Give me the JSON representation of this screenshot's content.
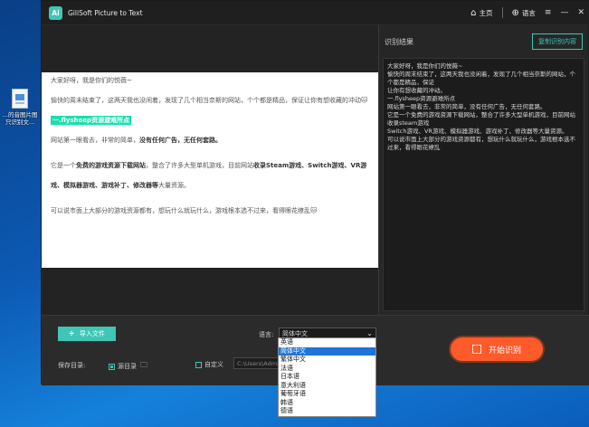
{
  "desktop": {
    "icon_label_line1": "…的音图片图",
    "icon_label_line2": "只识别文..."
  },
  "titlebar": {
    "logo_text": "Ai",
    "app_title": "GiliSoft Picture to Text",
    "home_label": "主页",
    "language_label": "语言"
  },
  "document": {
    "p1": "大家好呀，我是你们的悦薇~",
    "p2": "愉快的周末结束了，这两天我也没闲着，发现了几个相当奈斯的网站，个个都是精品，保证让你有想收藏的冲动🐱",
    "heading": "一.flysheep资源避难所点",
    "p3a": "网站第一眼看去，非常的简单，",
    "p3b": "没有任何广告，无任何套路。",
    "p4a": "它是一个",
    "p4b": "免费的游戏资源下载网站",
    "p4c": "，整合了许多大型单机游戏，目前网站",
    "p4d": "收录Steam游戏、Switch游戏、VR游戏、模拟器游戏、游戏补丁、修改器等",
    "p4e": "大量资源。",
    "p5": "可以说市面上大部分的游戏资源都有，想玩什么就玩什么，游戏根本选不过来，看得眼花缭乱🐱"
  },
  "result": {
    "title": "识别结果",
    "copy_label": "复制识别内容",
    "text": "大家好呀，我是你们的悦薇~\n愉快的周末结束了，这两天我也没闲着，发现了几个相当奈斯的网站，个个都是精品，保证\n让你有想收藏的冲动。\n一.flysheep资源避难所点\n网站第一眼看去，非常的简单，没有任何广告，无任何套路。\n它是一个免费的游戏资源下载网站，整合了许多大型单机游戏，目前网站收录steam游戏\nSwitch游戏、VR游戏、模拟器游戏、游戏补丁、修改器等大量资源。\n可以说市面上大部分的游戏资源都有，想玩什么就玩什么，游戏根本选不过来，看得眼花缭乱"
  },
  "toolbar": {
    "import_label": "导入文件",
    "language_label": "语言:",
    "language_value": "简体中文",
    "save_dir_label": "保存目录:",
    "source_dir_label": "源目录",
    "custom_label": "自定义",
    "path_value": "C:\\Users\\Admin",
    "start_label": "开始识别"
  },
  "language_options": [
    "英语",
    "简体中文",
    "繁体中文",
    "法语",
    "日本语",
    "意大利语",
    "葡萄牙语",
    "韩语",
    "德语"
  ],
  "selected_language_index": 1,
  "colors": {
    "accent": "#3ec6b6",
    "start_button": "#ff5a2a",
    "highlight": "#17e0ac",
    "selection": "#1e74d9"
  }
}
